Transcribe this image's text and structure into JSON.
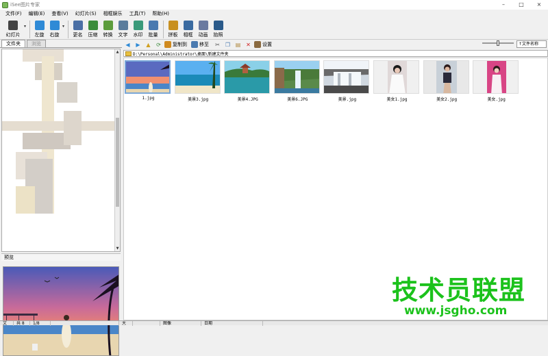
{
  "window": {
    "title": "iSee图片专家",
    "controls": [
      "–",
      "□",
      "×"
    ]
  },
  "menu": [
    "文件(F)",
    "编辑(E)",
    "查看(V)",
    "幻灯片(S)",
    "相框娱乐",
    "工具(T)",
    "帮助(H)"
  ],
  "toolbar": {
    "groups": [
      [
        {
          "label": "幻灯片",
          "icon": "slideshow-icon",
          "color": "#444444"
        }
      ],
      [
        {
          "label": "左旋",
          "icon": "rotate-left-icon",
          "color": "#2f8ad6"
        },
        {
          "label": "右旋",
          "icon": "rotate-right-icon",
          "color": "#2f8ad6"
        }
      ],
      [
        {
          "label": "更名",
          "icon": "rename-icon",
          "color": "#4a6fa5"
        },
        {
          "label": "压缩",
          "icon": "compress-icon",
          "color": "#3c8c3c"
        },
        {
          "label": "转换",
          "icon": "convert-icon",
          "color": "#5c9c3c"
        },
        {
          "label": "文字",
          "icon": "text-icon",
          "color": "#5a7c9c"
        },
        {
          "label": "水印",
          "icon": "watermark-icon",
          "color": "#3a9a7a"
        },
        {
          "label": "批量",
          "icon": "batch-icon",
          "color": "#4a7ab0"
        }
      ],
      [
        {
          "label": "拼板",
          "icon": "collage-icon",
          "color": "#c89020"
        },
        {
          "label": "相框",
          "icon": "frame-icon",
          "color": "#3a6aa0"
        },
        {
          "label": "动画",
          "icon": "animation-icon",
          "color": "#6a7aa0"
        },
        {
          "label": "抬照",
          "icon": "camera-icon",
          "color": "#2a5a8a"
        }
      ]
    ]
  },
  "left_panel": {
    "tabs": [
      {
        "label": "文件夹",
        "active": true
      },
      {
        "label": "浏览",
        "active": false
      }
    ],
    "preview_label": "预览"
  },
  "nav": {
    "copy_to": "复制到",
    "move_to": "移至",
    "settings": "设置",
    "sort_selected": "↑文件名称",
    "zoom_level": 0.5
  },
  "address": "D:\\Personal\\Administrator\\桌面\\新建文件夹",
  "thumbnails": [
    {
      "name": "1.jpg",
      "selected": true,
      "scene": "beach"
    },
    {
      "name": "美景3.jpg",
      "selected": false,
      "scene": "sea"
    },
    {
      "name": "美景4.JPG",
      "selected": false,
      "scene": "lake"
    },
    {
      "name": "美景6.JPG",
      "selected": false,
      "scene": "waterfall"
    },
    {
      "name": "美景.jpg",
      "selected": false,
      "scene": "falls"
    },
    {
      "name": "美女1.jpg",
      "selected": false,
      "scene": "girl1"
    },
    {
      "name": "美女2.jpg",
      "selected": false,
      "scene": "girl2"
    },
    {
      "name": "美女.jpg",
      "selected": false,
      "scene": "girl3"
    }
  ],
  "statusbar": [
    "文件",
    "共 8",
    "1/8",
    "",
    "大小",
    "",
    "图像",
    "日期"
  ],
  "watermark": {
    "big": "技术员联盟",
    "small": "www.jsgho.com"
  }
}
